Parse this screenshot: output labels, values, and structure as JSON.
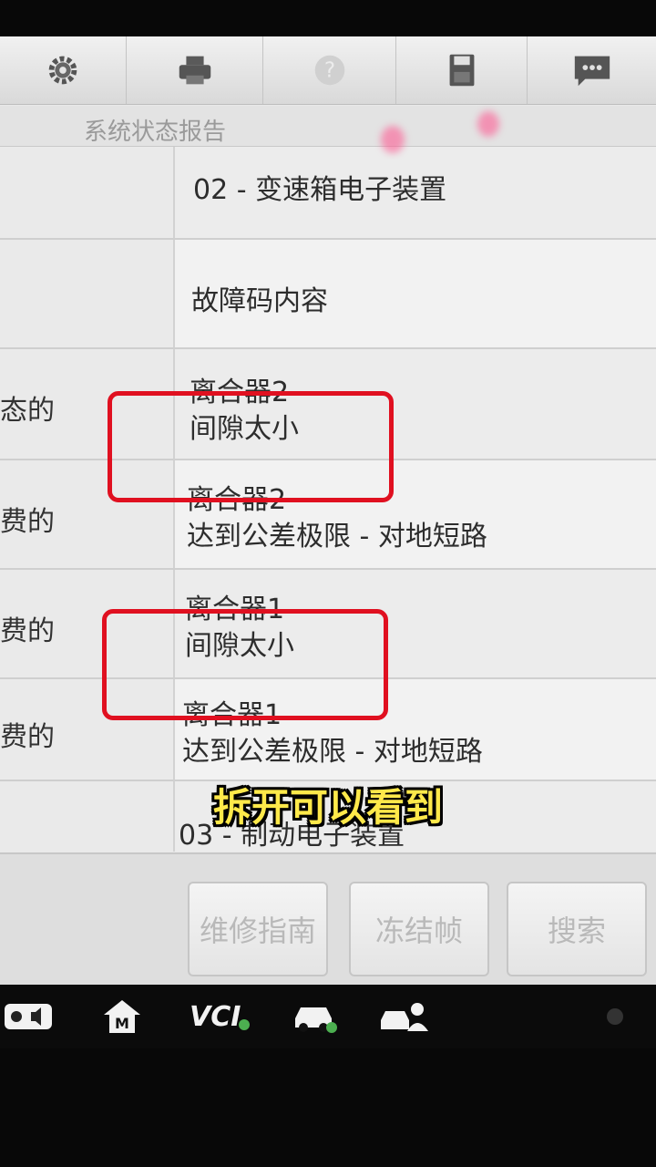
{
  "toolbar": {
    "icons": [
      "settings-icon",
      "print-icon",
      "help-icon",
      "save-icon",
      "message-icon"
    ]
  },
  "subtitle": "系统状态报告",
  "rows": [
    {
      "left": "",
      "line1": "02 - 变速箱电子装置",
      "line2": ""
    },
    {
      "left": "",
      "line1": "故障码内容",
      "line2": ""
    },
    {
      "left": "态的",
      "line1": "离合器2",
      "line2": "间隙太小"
    },
    {
      "left": "费的",
      "line1": "离合器2",
      "line2": "达到公差极限 - 对地短路"
    },
    {
      "left": "费的",
      "line1": "离合器1",
      "line2": "间隙太小"
    },
    {
      "left": "费的",
      "line1": "离合器1",
      "line2": "达到公差极限 - 对地短路"
    },
    {
      "left": "",
      "line1": "03 - 制动电子装置",
      "line2": ""
    }
  ],
  "buttons": {
    "repair_guide": "维修指南",
    "freeze_frame": "冻结帧",
    "search": "搜索"
  },
  "sysbar": {
    "vci_label": "VCI",
    "home_label": "M"
  },
  "caption": "拆开可以看到",
  "colors": {
    "highlight": "#e01020",
    "caption": "#ffe94a"
  }
}
